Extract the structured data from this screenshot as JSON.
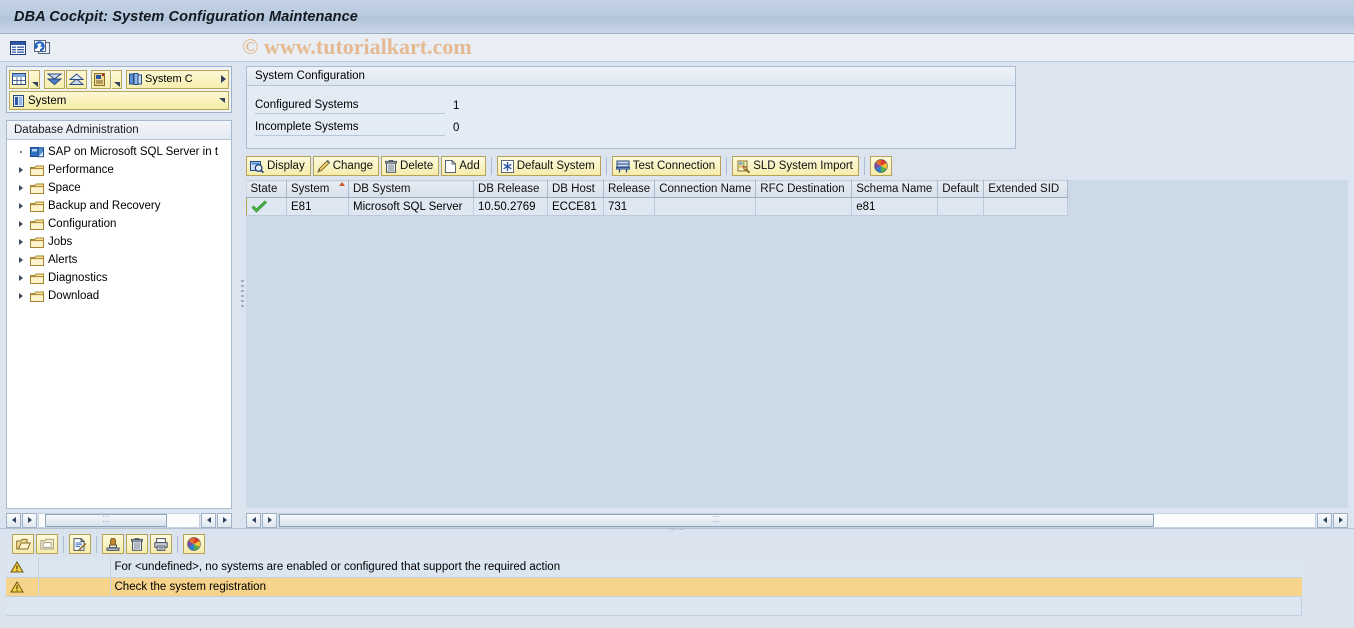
{
  "window": {
    "title": "DBA Cockpit: System Configuration Maintenance"
  },
  "watermark": "© www.tutorialkart.com",
  "app_toolbar": {
    "buttons": [
      {
        "name": "layout-list-icon",
        "icon": "list-layout-icon"
      },
      {
        "name": "refresh-icon",
        "icon": "refresh-icon"
      }
    ]
  },
  "tree_panel": {
    "toolbar": {
      "table_view_label": "",
      "expand_all_label": "",
      "collapse_all_label": "",
      "settings_label": "",
      "system_dropdown_label": "System C"
    },
    "system_selector": {
      "label": "System"
    },
    "header": "Database Administration",
    "nodes": [
      {
        "label": "SAP on Microsoft SQL Server in t",
        "icon": "system-icon",
        "expander": "leaf"
      },
      {
        "label": "Performance",
        "icon": "folder-icon",
        "expander": "collapsed"
      },
      {
        "label": "Space",
        "icon": "folder-icon",
        "expander": "collapsed"
      },
      {
        "label": "Backup and Recovery",
        "icon": "folder-icon",
        "expander": "collapsed"
      },
      {
        "label": "Configuration",
        "icon": "folder-icon",
        "expander": "collapsed"
      },
      {
        "label": "Jobs",
        "icon": "folder-icon",
        "expander": "collapsed"
      },
      {
        "label": "Alerts",
        "icon": "folder-icon",
        "expander": "collapsed"
      },
      {
        "label": "Diagnostics",
        "icon": "folder-icon",
        "expander": "collapsed"
      },
      {
        "label": "Download",
        "icon": "folder-icon",
        "expander": "collapsed"
      }
    ]
  },
  "system_configuration": {
    "group_title": "System Configuration",
    "fields": [
      {
        "label": "Configured Systems",
        "value": "1"
      },
      {
        "label": "Incomplete Systems",
        "value": "0"
      }
    ]
  },
  "alv_toolbar": {
    "buttons": [
      {
        "label": "Display",
        "icon": "magnifier-display-icon"
      },
      {
        "label": "Change",
        "icon": "pencil-icon"
      },
      {
        "label": "Delete",
        "icon": "trash-icon"
      },
      {
        "label": "Add",
        "icon": "new-page-icon"
      },
      {
        "label": "Default System",
        "icon": "asterisk-icon"
      },
      {
        "label": "Test Connection",
        "icon": "connection-icon"
      },
      {
        "label": "SLD System Import",
        "icon": "import-icon"
      }
    ],
    "color_button": {
      "label": "",
      "icon": "color-wheel-icon"
    }
  },
  "systems_table": {
    "columns": [
      {
        "label": "State",
        "width": 40
      },
      {
        "label": "System",
        "width": 62,
        "sorted": true
      },
      {
        "label": "DB System",
        "width": 125
      },
      {
        "label": "DB Release",
        "width": 74
      },
      {
        "label": "DB Host",
        "width": 56
      },
      {
        "label": "Release",
        "width": 46
      },
      {
        "label": "Connection Name",
        "width": 100
      },
      {
        "label": "RFC Destination",
        "width": 96
      },
      {
        "label": "Schema Name",
        "width": 86
      },
      {
        "label": "Default",
        "width": 46
      },
      {
        "label": "Extended SID",
        "width": 84
      }
    ],
    "rows": [
      {
        "state": "ok-check-icon",
        "system": "E81",
        "db_system": "Microsoft SQL Server",
        "db_release": "10.50.2769",
        "db_host": "ECCE81",
        "release": "731",
        "connection_name": "",
        "rfc_destination": "",
        "schema_name": "e81",
        "default": "",
        "extended_sid": ""
      }
    ]
  },
  "message_panel": {
    "toolbar": [
      {
        "name": "expand-messages-icon",
        "icon": "folder-open-icon"
      },
      {
        "name": "collapse-messages-icon",
        "icon": "folder-closed-icon"
      },
      {
        "name": "message-long-text-icon",
        "icon": "document-edit-icon"
      },
      {
        "name": "save-messages-icon",
        "icon": "save-stamp-icon"
      },
      {
        "name": "delete-messages-icon",
        "icon": "trash-icon"
      },
      {
        "name": "print-messages-icon",
        "icon": "printer-icon"
      },
      {
        "name": "color-legend-icon",
        "icon": "color-wheel-icon"
      }
    ],
    "messages": [
      {
        "severity": "warning",
        "text": "For <undefined>, no systems are enabled or configured that support the required action",
        "selected": false
      },
      {
        "severity": "warning",
        "text": "Check the system registration",
        "selected": true
      }
    ]
  },
  "colors": {
    "title_bar": "#bacbe0",
    "button_yellow": "#f5ecab",
    "selected_row": "#f7d48b",
    "grid_cell": "#dfe8f2",
    "accent_sort": "#d4572a",
    "watermark": "#e5b183"
  }
}
